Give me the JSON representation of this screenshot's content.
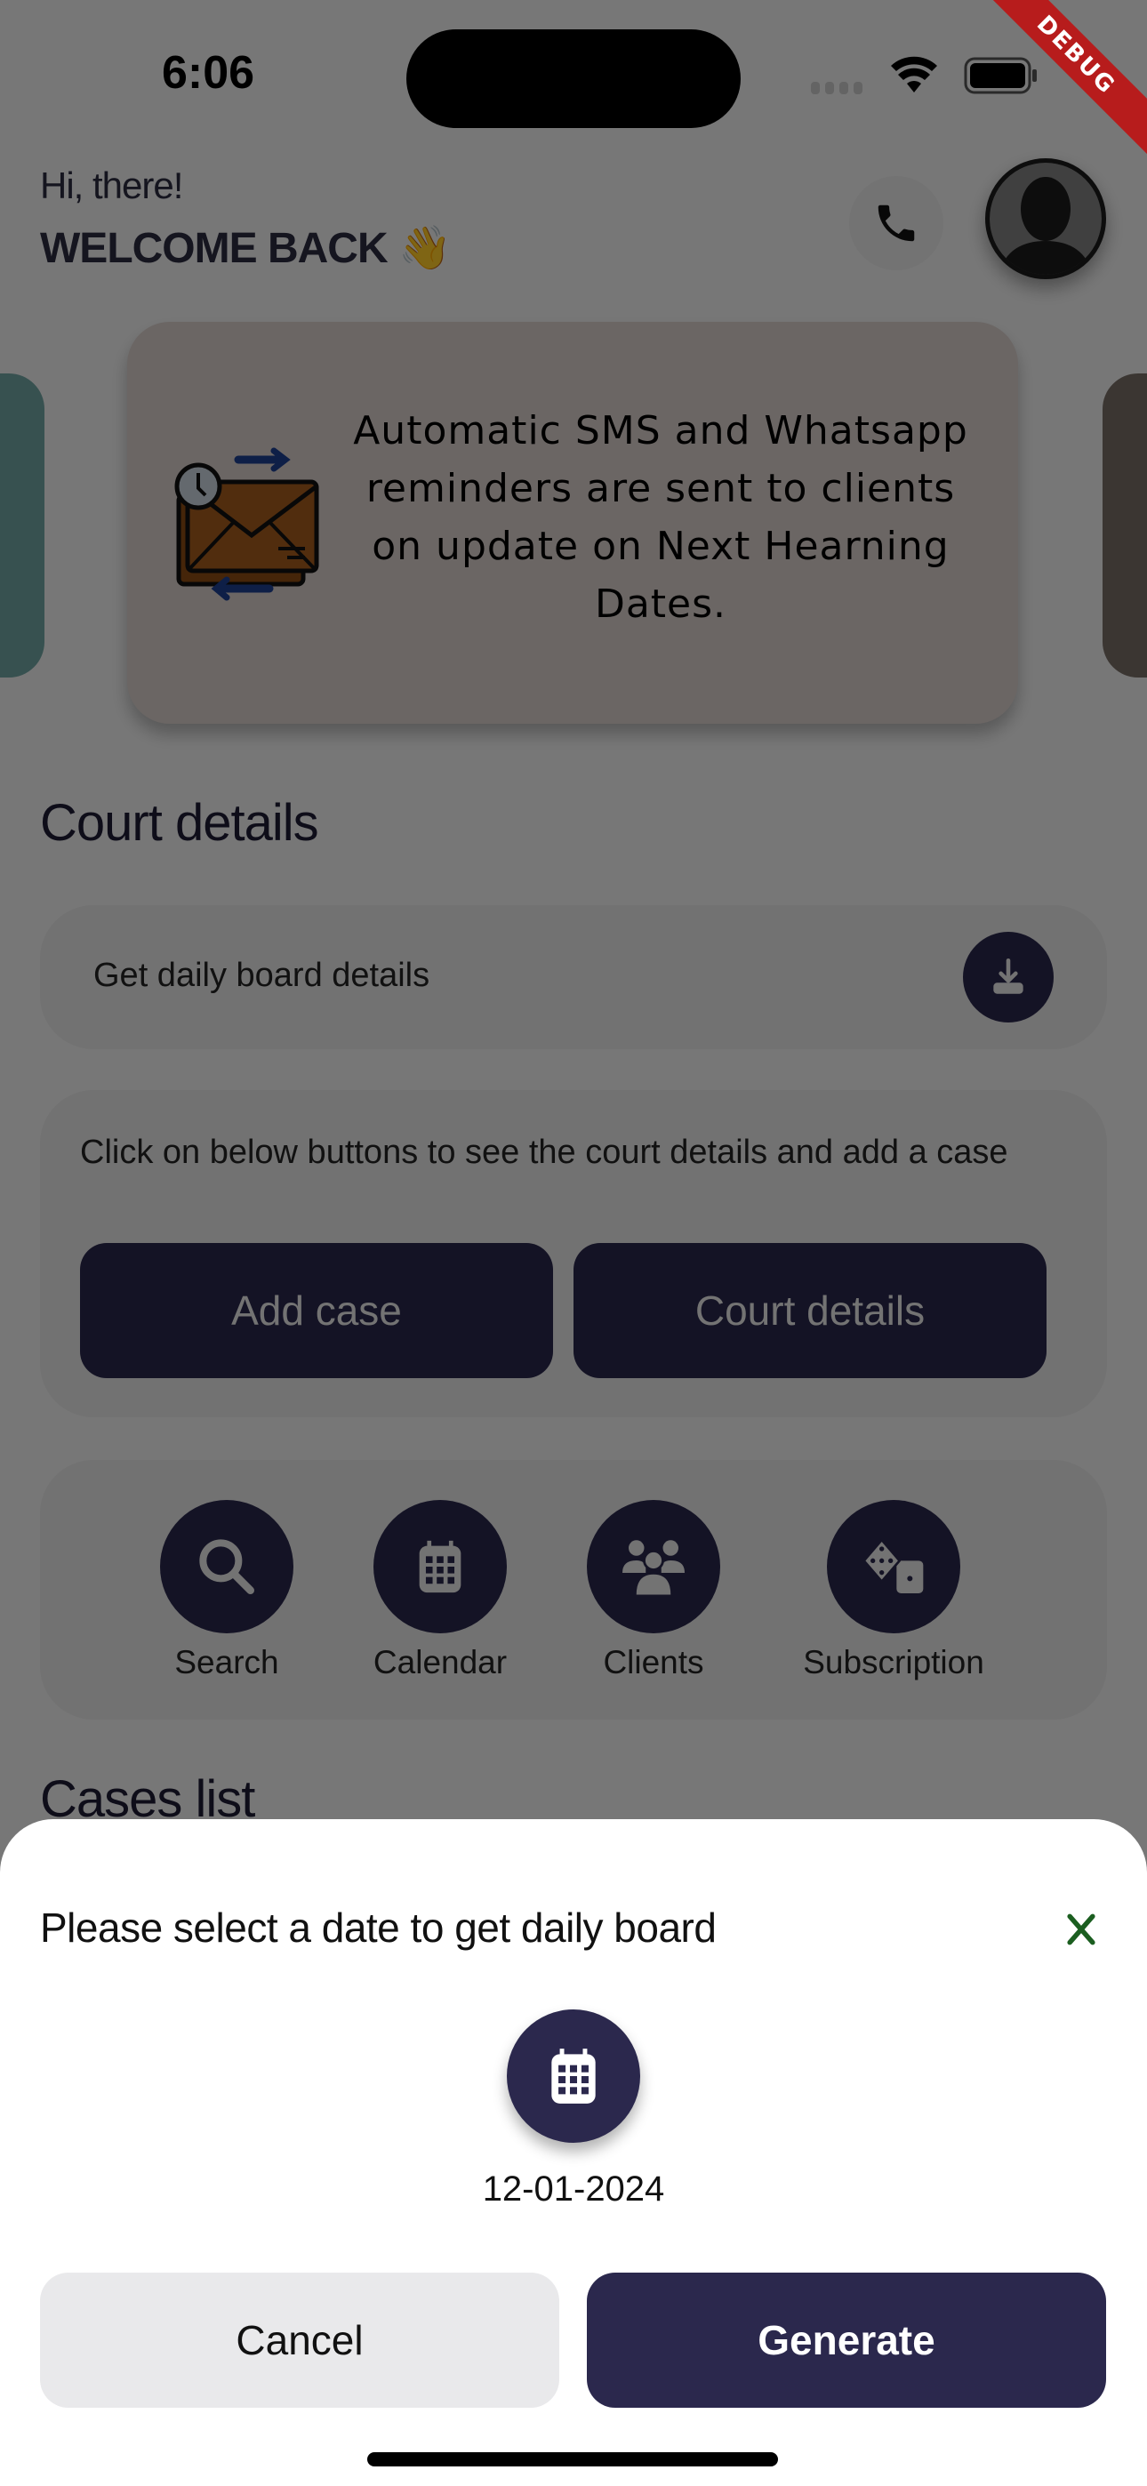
{
  "status_bar": {
    "time": "6:06",
    "debug_banner": "DEBUG"
  },
  "header": {
    "greeting": "Hi, there!",
    "welcome": "WELCOME BACK 👋",
    "phone_icon": "phone-icon",
    "avatar_icon": "user-avatar-icon"
  },
  "banner": {
    "text": "Automatic SMS and Whatsapp reminders are sent to clients on update on Next Hearning Dates.",
    "icon": "envelope-reminder-icon"
  },
  "court_details": {
    "title": "Court details",
    "daily_board_label": "Get daily board details",
    "hint": "Click on below buttons to see the court details and add a case",
    "add_case_label": "Add case",
    "court_details_label": "Court details"
  },
  "quick_actions": [
    {
      "label": "Search",
      "icon": "search-icon"
    },
    {
      "label": "Calendar",
      "icon": "calendar-icon"
    },
    {
      "label": "Clients",
      "icon": "clients-icon"
    },
    {
      "label": "Subscription",
      "icon": "dice-icon"
    }
  ],
  "cases_list": {
    "title": "Cases list"
  },
  "sheet": {
    "title": "Please select a date to get daily board",
    "selected_date": "12-01-2024",
    "cancel_label": "Cancel",
    "generate_label": "Generate"
  },
  "colors": {
    "primary": "#2b284d",
    "close_icon": "#1b5e20",
    "debug": "#b71c1c"
  }
}
